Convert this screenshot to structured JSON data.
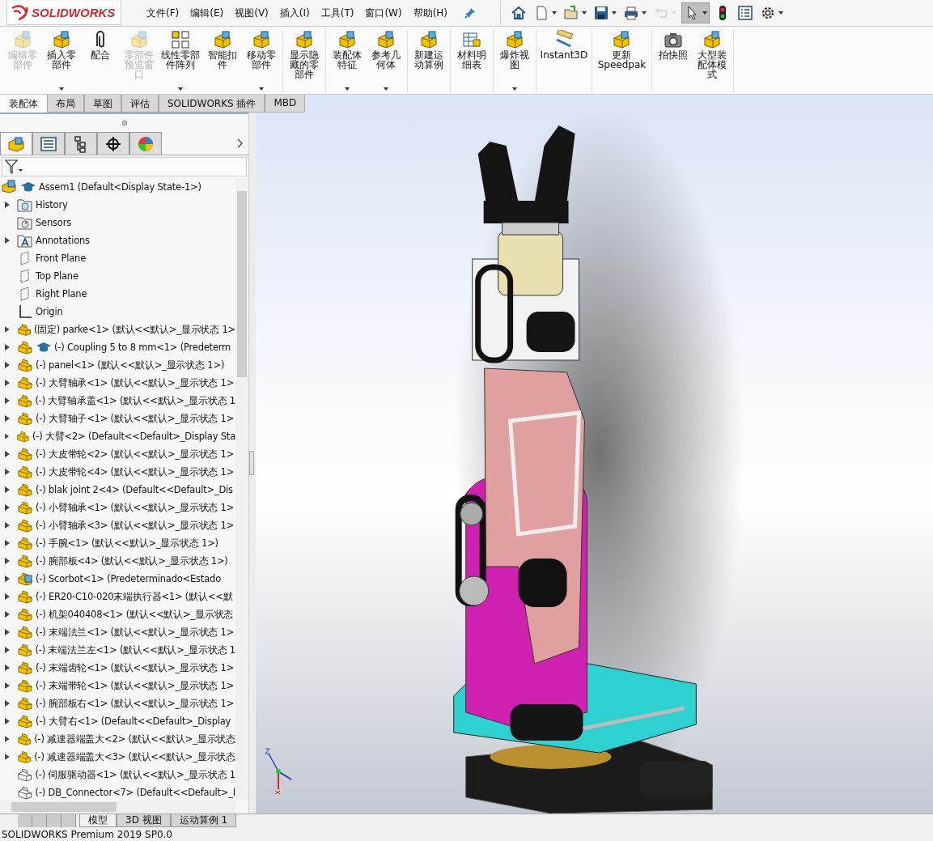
{
  "app": {
    "logo_text": "SOLIDWORKS"
  },
  "menu": [
    "文件(F)",
    "编辑(E)",
    "视图(V)",
    "插入(I)",
    "工具(T)",
    "窗口(W)",
    "帮助(H)"
  ],
  "quick_toolbar": [
    {
      "kind": "home",
      "dropdown": false,
      "disabled": false,
      "selected": false
    },
    {
      "kind": "new",
      "dropdown": true,
      "disabled": false,
      "selected": false
    },
    {
      "kind": "open",
      "dropdown": true,
      "disabled": false,
      "selected": false
    },
    {
      "kind": "save",
      "dropdown": true,
      "disabled": false,
      "selected": false
    },
    {
      "kind": "print",
      "dropdown": true,
      "disabled": false,
      "selected": false
    },
    {
      "kind": "undo",
      "dropdown": true,
      "disabled": true,
      "selected": false
    },
    {
      "kind": "select",
      "dropdown": true,
      "disabled": false,
      "selected": true
    },
    {
      "kind": "rebuild",
      "dropdown": false,
      "disabled": false,
      "selected": false
    },
    {
      "kind": "properties",
      "dropdown": false,
      "disabled": false,
      "selected": false
    },
    {
      "kind": "options",
      "dropdown": true,
      "disabled": false,
      "selected": false
    }
  ],
  "ribbon_groups": [
    [
      {
        "label": "编辑零部件",
        "kind": "part",
        "disabled": true,
        "dropdown": false
      },
      {
        "label": "插入零部件",
        "kind": "part",
        "disabled": false,
        "dropdown": true
      },
      {
        "label": "配合",
        "kind": "mate",
        "disabled": false,
        "dropdown": false
      },
      {
        "label": "零部件预览窗口",
        "kind": "part",
        "disabled": true,
        "dropdown": false
      },
      {
        "label": "线性零部件阵列",
        "kind": "pattern",
        "disabled": false,
        "dropdown": true
      },
      {
        "label": "智能扣件",
        "kind": "part",
        "disabled": false,
        "dropdown": false
      },
      {
        "label": "移动零部件",
        "kind": "part",
        "disabled": false,
        "dropdown": true
      }
    ],
    [
      {
        "label": "显示隐藏的零部件",
        "kind": "part",
        "disabled": false,
        "dropdown": false
      }
    ],
    [
      {
        "label": "装配体特征",
        "kind": "part",
        "disabled": false,
        "dropdown": true
      },
      {
        "label": "参考几何体",
        "kind": "part",
        "disabled": false,
        "dropdown": true
      }
    ],
    [
      {
        "label": "新建运动算例",
        "kind": "part",
        "disabled": false,
        "dropdown": false
      }
    ],
    [
      {
        "label": "材料明细表",
        "kind": "bom",
        "disabled": false,
        "dropdown": false
      }
    ],
    [
      {
        "label": "爆炸视图",
        "kind": "part",
        "disabled": false,
        "dropdown": true
      }
    ],
    [
      {
        "label": "Instant3D",
        "kind": "instant3d",
        "disabled": false,
        "dropdown": false
      }
    ],
    [
      {
        "label": "更新 Speedpak",
        "kind": "speedpak",
        "disabled": false,
        "dropdown": false
      }
    ],
    [
      {
        "label": "拍快照",
        "kind": "snapshot",
        "disabled": false,
        "dropdown": false
      },
      {
        "label": "大型装配体模式",
        "kind": "part",
        "disabled": false,
        "dropdown": false
      }
    ]
  ],
  "command_tabs": [
    {
      "label": "装配体",
      "selected": true
    },
    {
      "label": "布局",
      "selected": false
    },
    {
      "label": "草图",
      "selected": false
    },
    {
      "label": "评估",
      "selected": false
    },
    {
      "label": "SOLIDWORKS 插件",
      "selected": false
    },
    {
      "label": "MBD",
      "selected": false
    }
  ],
  "panel_tabs": [
    {
      "kind": "feature-tree",
      "selected": true
    },
    {
      "kind": "property",
      "selected": false
    },
    {
      "kind": "configuration",
      "selected": false
    },
    {
      "kind": "dimxpert",
      "selected": false
    },
    {
      "kind": "display",
      "selected": false
    }
  ],
  "tree": {
    "label": "Assem1  (Default<Display State-1>)",
    "kind": "assembly",
    "mortarboard": true,
    "children": [
      {
        "label": "History",
        "kind": "history",
        "expandable": true,
        "mortarboard": false
      },
      {
        "label": "Sensors",
        "kind": "sensors",
        "expandable": false,
        "mortarboard": false
      },
      {
        "label": "Annotations",
        "kind": "annotations",
        "expandable": true,
        "mortarboard": false
      },
      {
        "label": "Front Plane",
        "kind": "plane",
        "expandable": false,
        "mortarboard": false
      },
      {
        "label": "Top Plane",
        "kind": "plane",
        "expandable": false,
        "mortarboard": false
      },
      {
        "label": "Right Plane",
        "kind": "plane",
        "expandable": false,
        "mortarboard": false
      },
      {
        "label": "Origin",
        "kind": "origin",
        "expandable": false,
        "mortarboard": false
      },
      {
        "label": "(固定) parke<1> (默认<<默认>_显示状态 1>",
        "kind": "part",
        "expandable": true,
        "mortarboard": false
      },
      {
        "label": "(-) Coupling 5 to 8 mm<1> (Predeterm",
        "kind": "part",
        "expandable": true,
        "mortarboard": true
      },
      {
        "label": "(-) panel<1> (默认<<默认>_显示状态 1>)",
        "kind": "part",
        "expandable": true,
        "mortarboard": false
      },
      {
        "label": "(-) 大臂轴承<1> (默认<<默认>_显示状态 1>",
        "kind": "part",
        "expandable": true,
        "mortarboard": false
      },
      {
        "label": "(-) 大臂轴承盖<1> (默认<<默认>_显示状态 1",
        "kind": "part",
        "expandable": true,
        "mortarboard": false
      },
      {
        "label": "(-) 大臂轴子<1> (默认<<默认>_显示状态 1>",
        "kind": "part",
        "expandable": true,
        "mortarboard": false
      },
      {
        "label": "(-) 大臂<2> (Default<<Default>_Display Sta",
        "kind": "part",
        "expandable": true,
        "mortarboard": false
      },
      {
        "label": "(-) 大皮带轮<2> (默认<<默认>_显示状态 1>",
        "kind": "part",
        "expandable": true,
        "mortarboard": false
      },
      {
        "label": "(-) 大皮带轮<4> (默认<<默认>_显示状态 1>",
        "kind": "part",
        "expandable": true,
        "mortarboard": false
      },
      {
        "label": "(-) blak joint 2<4> (Default<<Default>_Dis",
        "kind": "part",
        "expandable": true,
        "mortarboard": false
      },
      {
        "label": "(-) 小臂轴承<1> (默认<<默认>_显示状态 1>",
        "kind": "part",
        "expandable": true,
        "mortarboard": false
      },
      {
        "label": "(-) 小臂轴承<3> (默认<<默认>_显示状态 1>",
        "kind": "part",
        "expandable": true,
        "mortarboard": false
      },
      {
        "label": "(-) 手腕<1> (默认<<默认>_显示状态 1>)",
        "kind": "part",
        "expandable": true,
        "mortarboard": false
      },
      {
        "label": "(-) 腕部板<4> (默认<<默认>_显示状态 1>)",
        "kind": "part",
        "expandable": true,
        "mortarboard": false
      },
      {
        "label": "(-) Scorbot<1> (Predeterminado<Estado",
        "kind": "subassembly",
        "expandable": true,
        "mortarboard": false
      },
      {
        "label": "(-) ER20-C10-020末端执行器<1> (默认<<默",
        "kind": "part",
        "expandable": true,
        "mortarboard": false
      },
      {
        "label": "(-) 机架040408<1> (默认<<默认>_显示状态",
        "kind": "part",
        "expandable": true,
        "mortarboard": false
      },
      {
        "label": "(-) 末端法兰<1> (默认<<默认>_显示状态 1>",
        "kind": "part",
        "expandable": true,
        "mortarboard": false
      },
      {
        "label": "(-) 末端法兰左<1> (默认<<默认>_显示状态 1",
        "kind": "part",
        "expandable": true,
        "mortarboard": false
      },
      {
        "label": "(-) 末端齿轮<1> (默认<<默认>_显示状态 1>",
        "kind": "part",
        "expandable": true,
        "mortarboard": false
      },
      {
        "label": "(-) 末端带轮<1> (默认<<默认>_显示状态 1>",
        "kind": "part",
        "expandable": true,
        "mortarboard": false
      },
      {
        "label": "(-) 腕部板右<1> (默认<<默认>_显示状态 1>",
        "kind": "part",
        "expandable": true,
        "mortarboard": false
      },
      {
        "label": "(-) 大臂右<1> (Default<<Default>_Display",
        "kind": "part",
        "expandable": true,
        "mortarboard": false
      },
      {
        "label": "(-) 减速器端盖大<2> (默认<<默认>_显示状态",
        "kind": "part",
        "expandable": true,
        "mortarboard": false
      },
      {
        "label": "(-) 减速器端盖大<3> (默认<<默认>_显示状态",
        "kind": "part",
        "expandable": true,
        "mortarboard": false
      },
      {
        "label": "(-) 伺服驱动器<1> (默认<<默认>_显示状态 1",
        "kind": "outline-part",
        "expandable": false,
        "mortarboard": false
      },
      {
        "label": "(-) DB_Connector<7> (Default<<Default>_I",
        "kind": "outline-part",
        "expandable": false,
        "mortarboard": false
      }
    ]
  },
  "bottom_tabs": [
    {
      "label": "模型",
      "selected": true
    },
    {
      "label": "3D 视图",
      "selected": false
    },
    {
      "label": "运动算例 1",
      "selected": false
    }
  ],
  "status_bar": "SOLIDWORKS Premium 2019 SP0.0"
}
